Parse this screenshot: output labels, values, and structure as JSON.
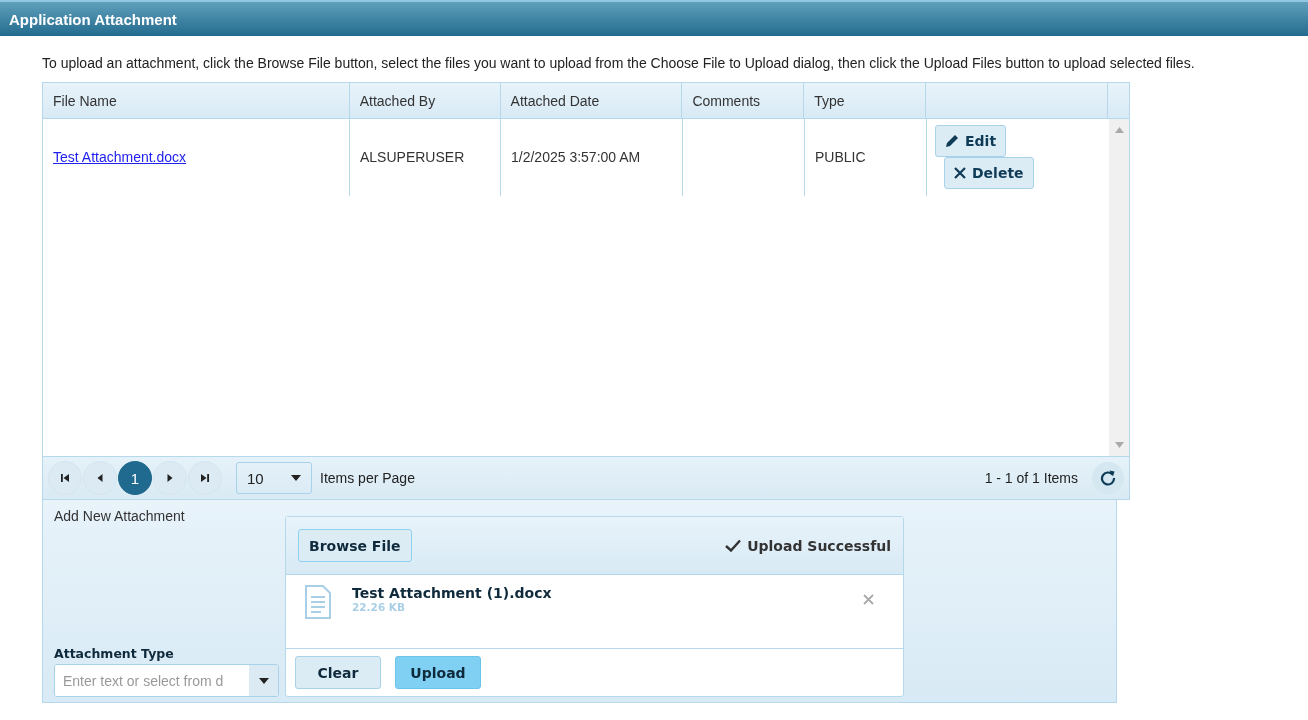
{
  "window": {
    "title": "Application Attachment"
  },
  "instructions": "To upload an attachment, click the Browse File button, select the files you want to upload from the Choose File to Upload dialog, then click the Upload Files button to upload selected files.",
  "table": {
    "columns": [
      "File Name",
      "Attached By",
      "Attached Date",
      "Comments",
      "Type"
    ],
    "rows": [
      {
        "file_name": "Test Attachment.docx",
        "attached_by": "ALSUPERUSER",
        "attached_date": "1/2/2025 3:57:00 AM",
        "comments": "",
        "type": "PUBLIC",
        "actions": [
          "Edit",
          "Delete"
        ]
      }
    ]
  },
  "pager": {
    "pages": [
      {
        "label": "1",
        "selected": true
      }
    ],
    "page_size": "10",
    "page_size_label": "Items per Page",
    "summary": "1 - 1 of 1 Items"
  },
  "add_attachment": {
    "title": "Add New Attachment",
    "type_label": "Attachment Type",
    "type_placeholder": "Enter text or select from d",
    "upload": {
      "browse": "Browse File",
      "status": "Upload Successful",
      "files": [
        {
          "name": "Test Attachment (1).docx",
          "size": "22.26 KB"
        }
      ],
      "buttons": [
        {
          "label": "Clear",
          "kind": "secondary"
        },
        {
          "label": "Upload",
          "kind": "primary"
        }
      ]
    }
  }
}
